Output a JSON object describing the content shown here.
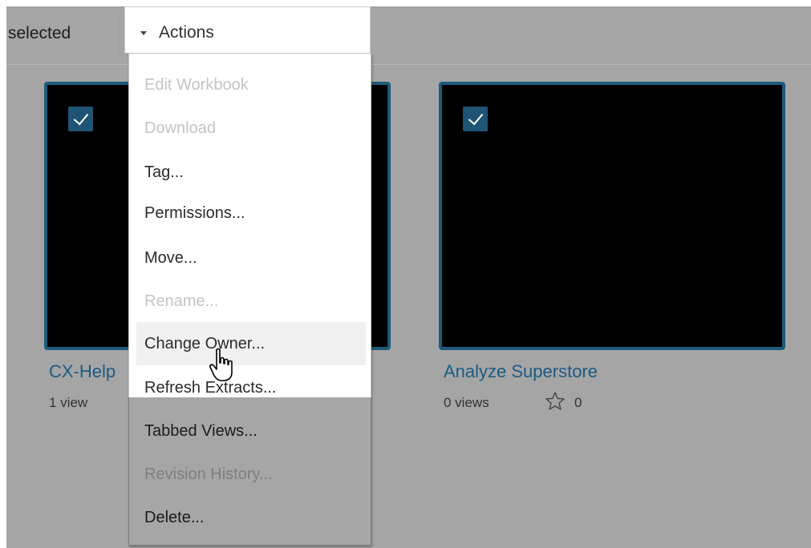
{
  "toolbar": {
    "selected_text": "selected",
    "actions_label": "Actions"
  },
  "workbooks": [
    {
      "name": "CX-Help",
      "views": "1 view",
      "checked": true
    },
    {
      "name": "Analyze Superstore",
      "views": "0 views",
      "favorites": "0",
      "checked": true
    }
  ],
  "menu": {
    "items": [
      {
        "label": "Edit Workbook",
        "enabled": false
      },
      {
        "label": "Download",
        "enabled": false
      },
      {
        "label": "Tag...",
        "enabled": true
      },
      {
        "label": "Permissions...",
        "enabled": true
      },
      {
        "label": "Move...",
        "enabled": true
      },
      {
        "label": "Rename...",
        "enabled": false
      },
      {
        "label": "Change Owner...",
        "enabled": true,
        "hovered": true
      },
      {
        "label": "Refresh Extracts...",
        "enabled": true
      },
      {
        "label": "Tabbed Views...",
        "enabled": true
      },
      {
        "label": "Revision History...",
        "enabled": false
      },
      {
        "label": "Delete...",
        "enabled": true
      }
    ]
  },
  "colors": {
    "background_overlay": "#a5a5a5",
    "card_border": "#1d5b7a",
    "checkbox": "#1e5474",
    "link": "#1c5b86",
    "disabled_text": "#c4c4c4",
    "hover_bg": "#f0f0f0"
  },
  "icons": {
    "caret": "caret-down-icon",
    "checkbox": "check-icon",
    "favorite": "star-outline-icon",
    "cursor": "hand-pointer-icon"
  }
}
